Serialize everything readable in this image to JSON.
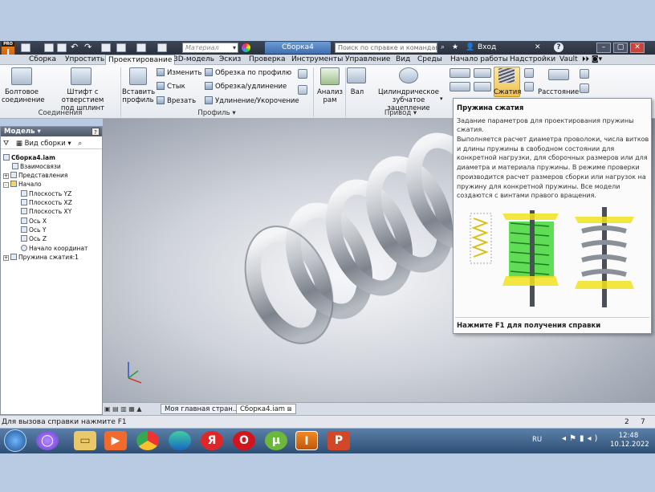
{
  "titlebar": {
    "logo_text": "I",
    "logo_sub": "PRO",
    "material_placeholder": "Материал",
    "document_tab": "Сборка4",
    "help_search_placeholder": "Поиск по справке и командам",
    "login_label": "Вход",
    "help_label": "?"
  },
  "menu": {
    "tabs": [
      "Сборка",
      "Упростить",
      "Проектирование",
      "3D-модель",
      "Эскиз",
      "Проверка",
      "Инструменты",
      "Управление",
      "Вид",
      "Среды",
      "Начало работы",
      "Надстройки",
      "Vault"
    ],
    "active": "Проектирование"
  },
  "ribbon": {
    "bolt_connection": "Болтовое\nсоединение",
    "pin_with_hole": "Штифт с отверстием\nпод шплинт",
    "insert_profile": "Вставить\nпрофиль",
    "change": "Изменить",
    "joint": "Стык",
    "cut_in": "Врезать",
    "trim_by_profile": "Обрезка по профилю",
    "trim_extend": "Обрезка/удлинение",
    "lengthen_shorten": "Удлинение/Укорочение",
    "frame_analysis": "Анализ\nрам",
    "shaft": "Вал",
    "spur_gear": "Цилиндрическое\nзубчатое зацепление",
    "compression": "Сжатия",
    "distance": "Расстояние",
    "panel_connections": "Соединения",
    "panel_profile": "Профиль ▾",
    "panel_drive": "Привод ▾"
  },
  "browser": {
    "header": "Модель ▾",
    "view_mode": "Вид сборки",
    "tree": [
      {
        "label": "Сборка4.iam",
        "bold": true,
        "level": 0
      },
      {
        "label": "Взаимосвязи",
        "level": 1
      },
      {
        "label": "Представления",
        "level": 1
      },
      {
        "label": "Начало",
        "level": 1
      },
      {
        "label": "Плоскость YZ",
        "level": 2
      },
      {
        "label": "Плоскость XZ",
        "level": 2
      },
      {
        "label": "Плоскость XY",
        "level": 2
      },
      {
        "label": "Ось X",
        "level": 2
      },
      {
        "label": "Ось Y",
        "level": 2
      },
      {
        "label": "Ось Z",
        "level": 2
      },
      {
        "label": "Начало координат",
        "level": 2
      },
      {
        "label": "Пружина сжатия:1",
        "level": 1
      }
    ]
  },
  "doctabs": {
    "home": "Моя главная стран...",
    "assembly": "Сборка4.iam"
  },
  "statusbar": {
    "hint": "Для вызова справки нажмите F1",
    "count_a": "2",
    "count_b": "7"
  },
  "tooltip": {
    "title": "Пружина сжатия",
    "subtitle": "Задание параметров для проектирования пружины сжатия.",
    "body": "Выполняется расчет диаметра проволоки, числа витков и длины пружины в свободном состоянии для конкретной нагрузки, для сборочных размеров или для диаметра и материала пружины. В режиме проверки производится расчет размеров сборки или нагрузок на пружину для конкретной пружины. Все модели создаются с винтами правого вращения.",
    "footer": "Нажмите F1 для получения справки"
  },
  "taskbar": {
    "language": "RU",
    "time": "12:48",
    "date": "10.12.2022"
  },
  "colors": {
    "accent": "#3f6eaf",
    "spring_highlight": "#45d63a",
    "spring_yellow": "#f2e21e"
  }
}
